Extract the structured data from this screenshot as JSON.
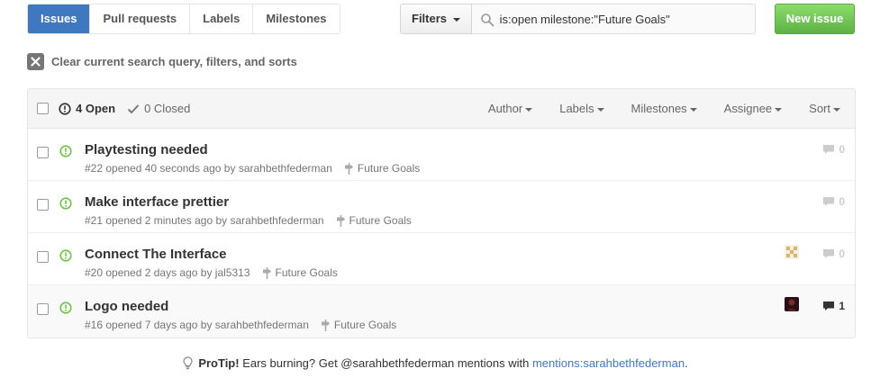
{
  "subnav": [
    {
      "label": "Issues",
      "selected": true
    },
    {
      "label": "Pull requests",
      "selected": false
    },
    {
      "label": "Labels",
      "selected": false
    },
    {
      "label": "Milestones",
      "selected": false
    }
  ],
  "filters": {
    "label": "Filters"
  },
  "search": {
    "value": "is:open milestone:\"Future Goals\""
  },
  "new_issue": {
    "label": "New issue"
  },
  "clear_query": {
    "label": "Clear current search query, filters, and sorts"
  },
  "states": {
    "open_label": "4 Open",
    "closed_label": "0 Closed"
  },
  "sort_menus": [
    "Author",
    "Labels",
    "Milestones",
    "Assignee",
    "Sort"
  ],
  "issues": [
    {
      "title": "Playtesting needed",
      "meta": "#22 opened 40 seconds ago by",
      "author": "sarahbethfederman",
      "milestone": "Future Goals",
      "comments": "0",
      "avatar": false
    },
    {
      "title": "Make interface prettier",
      "meta": "#21 opened 2 minutes ago by",
      "author": "sarahbethfederman",
      "milestone": "Future Goals",
      "comments": "0",
      "avatar": false
    },
    {
      "title": "Connect The Interface",
      "meta": "#20 opened 2 days ago by",
      "author": "jal5313",
      "milestone": "Future Goals",
      "comments": "0",
      "avatar": true
    },
    {
      "title": "Logo needed",
      "meta": "#16 opened 7 days ago by",
      "author": "sarahbethfederman",
      "milestone": "Future Goals",
      "comments": "1",
      "avatar": true
    }
  ],
  "protip": {
    "lead": "ProTip!",
    "text": " Ears burning? Get @sarahbethfederman mentions with ",
    "link": "mentions:sarahbethfederman",
    "end": "."
  },
  "colors": {
    "accent": "#4078c0",
    "open_green": "#6cc644",
    "new_issue_green": "#60b044"
  }
}
